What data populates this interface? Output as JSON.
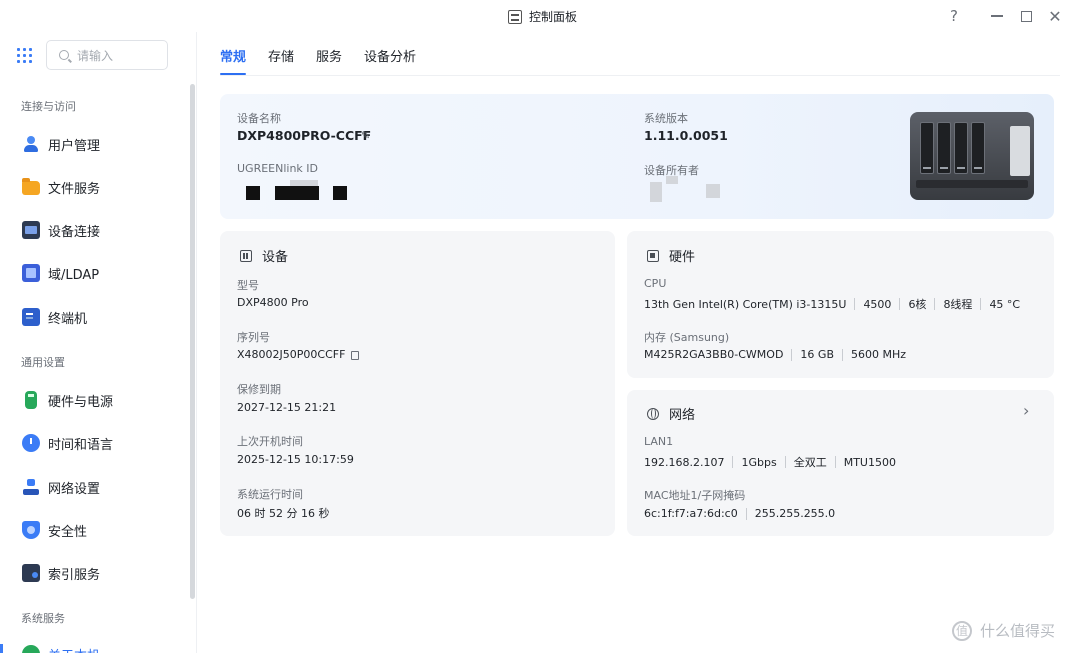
{
  "window": {
    "title": "控制面板"
  },
  "sidebar": {
    "search_placeholder": "请输入",
    "sections": [
      {
        "label": "连接与访问",
        "items": [
          {
            "label": "用户管理",
            "icon": "user-icon"
          },
          {
            "label": "文件服务",
            "icon": "folder-icon"
          },
          {
            "label": "设备连接",
            "icon": "device-icon"
          },
          {
            "label": "域/LDAP",
            "icon": "domain-icon"
          },
          {
            "label": "终端机",
            "icon": "terminal-icon"
          }
        ]
      },
      {
        "label": "通用设置",
        "items": [
          {
            "label": "硬件与电源",
            "icon": "power-icon"
          },
          {
            "label": "时间和语言",
            "icon": "clock-icon"
          },
          {
            "label": "网络设置",
            "icon": "network-icon"
          },
          {
            "label": "安全性",
            "icon": "shield-icon"
          },
          {
            "label": "索引服务",
            "icon": "index-icon"
          }
        ]
      },
      {
        "label": "系统服务",
        "items": [
          {
            "label": "关于本机",
            "icon": "overview-icon"
          }
        ]
      }
    ]
  },
  "tabs": [
    {
      "label": "常规",
      "active": true
    },
    {
      "label": "存储",
      "active": false
    },
    {
      "label": "服务",
      "active": false
    },
    {
      "label": "设备分析",
      "active": false
    }
  ],
  "hero": {
    "device_name_label": "设备名称",
    "device_name": "DXP4800PRO-CCFF",
    "ugreenlink_label": "UGREENlink ID",
    "system_version_label": "系统版本",
    "system_version": "1.11.0.0051",
    "owner_label": "设备所有者"
  },
  "device_card": {
    "title": "设备",
    "model_label": "型号",
    "model": "DXP4800 Pro",
    "serial_label": "序列号",
    "serial": "X48002J50P00CCFF",
    "warranty_label": "保修到期",
    "warranty": "2027-12-15 21:21",
    "last_boot_label": "上次开机时间",
    "last_boot": "2025-12-15 10:17:59",
    "uptime_label": "系统运行时间",
    "uptime": "06 时 52 分 16 秒"
  },
  "hardware_card": {
    "title": "硬件",
    "cpu_label": "CPU",
    "cpu_model": "13th Gen Intel(R) Core(TM) i3-1315U",
    "cpu_speed": "4500",
    "cpu_cores": "6核",
    "cpu_threads": "8线程",
    "cpu_temp": "45 °C",
    "memory_label": "内存 (Samsung)",
    "memory_model": "M425R2GA3BB0-CWMOD",
    "memory_size": "16 GB",
    "memory_speed": "5600 MHz"
  },
  "network_card": {
    "title": "网络",
    "lan_label": "LAN1",
    "ip": "192.168.2.107",
    "speed": "1Gbps",
    "duplex": "全双工",
    "mtu": "MTU1500",
    "mac_label": "MAC地址1/子网掩码",
    "mac": "6c:1f:f7:a7:6d:c0",
    "netmask": "255.255.255.0"
  },
  "watermark": "什么值得买",
  "colors": {
    "accent": "#2d6ff2",
    "card_bg": "#f5f6f8",
    "hero_bg": "#eef4fd"
  }
}
